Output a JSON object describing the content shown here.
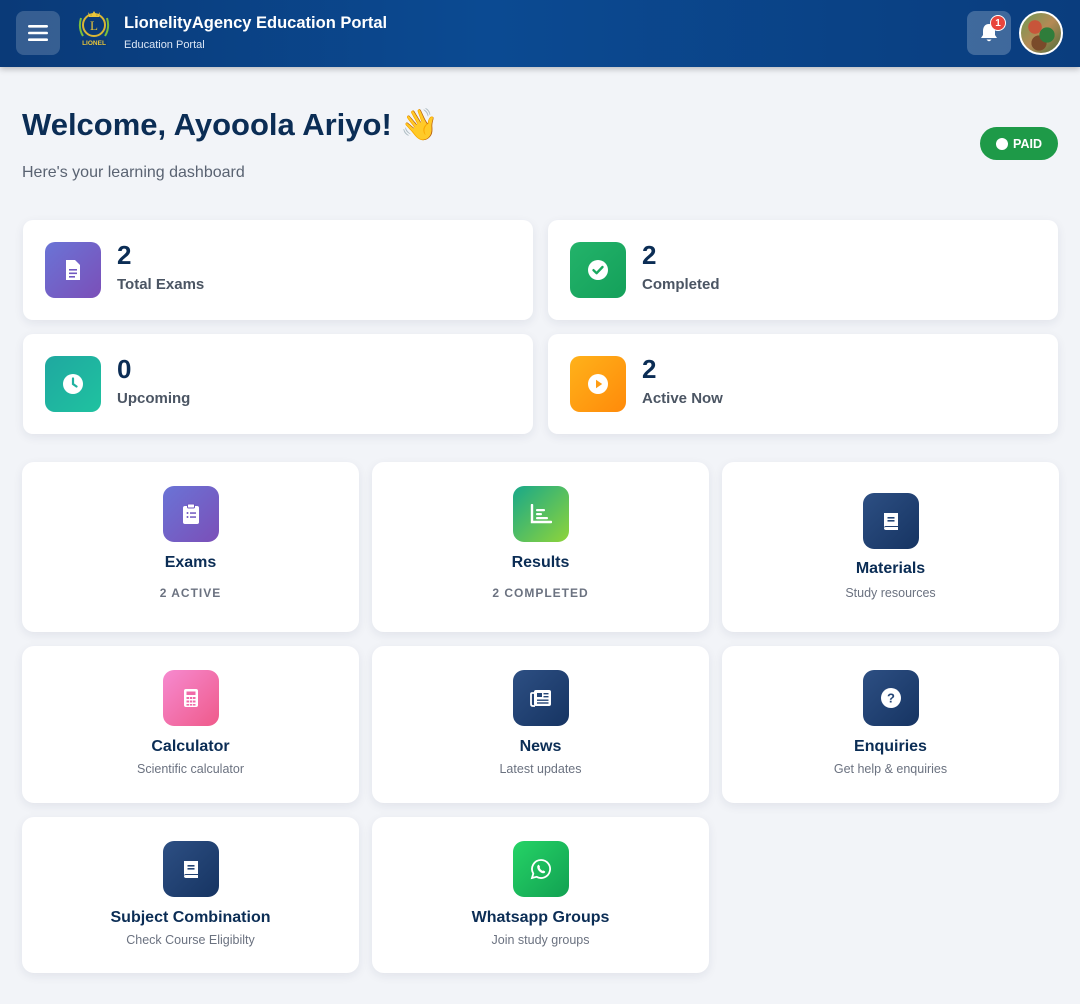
{
  "header": {
    "title": "LionelityAgency Education Portal",
    "subtitle": "Education Portal",
    "logo_text": "LIONEL",
    "notification_count": "1"
  },
  "welcome": {
    "heading": "Welcome, Ayooola Ariyo! 👋",
    "subtitle": "Here's your learning dashboard",
    "status_badge": "PAID"
  },
  "stats": [
    {
      "value": "2",
      "label": "Total Exams",
      "icon": "document-icon"
    },
    {
      "value": "2",
      "label": "Completed",
      "icon": "check-circle-icon"
    },
    {
      "value": "0",
      "label": "Upcoming",
      "icon": "clock-icon"
    },
    {
      "value": "2",
      "label": "Active Now",
      "icon": "play-circle-icon"
    }
  ],
  "features": [
    {
      "title": "Exams",
      "desc": "2 ACTIVE",
      "icon": "clipboard-icon"
    },
    {
      "title": "Results",
      "desc": "2 COMPLETED",
      "icon": "chart-icon"
    },
    {
      "title": "Materials",
      "desc": "Study resources",
      "icon": "book-icon"
    },
    {
      "title": "Calculator",
      "desc": "Scientific calculator",
      "icon": "calculator-icon"
    },
    {
      "title": "News",
      "desc": "Latest updates",
      "icon": "newspaper-icon"
    },
    {
      "title": "Enquiries",
      "desc": "Get help & enquiries",
      "icon": "question-icon"
    },
    {
      "title": "Subject Combination",
      "desc": "Check Course Eligibilty",
      "icon": "book-icon"
    },
    {
      "title": "Whatsapp Groups",
      "desc": "Join study groups",
      "icon": "whatsapp-icon"
    }
  ]
}
